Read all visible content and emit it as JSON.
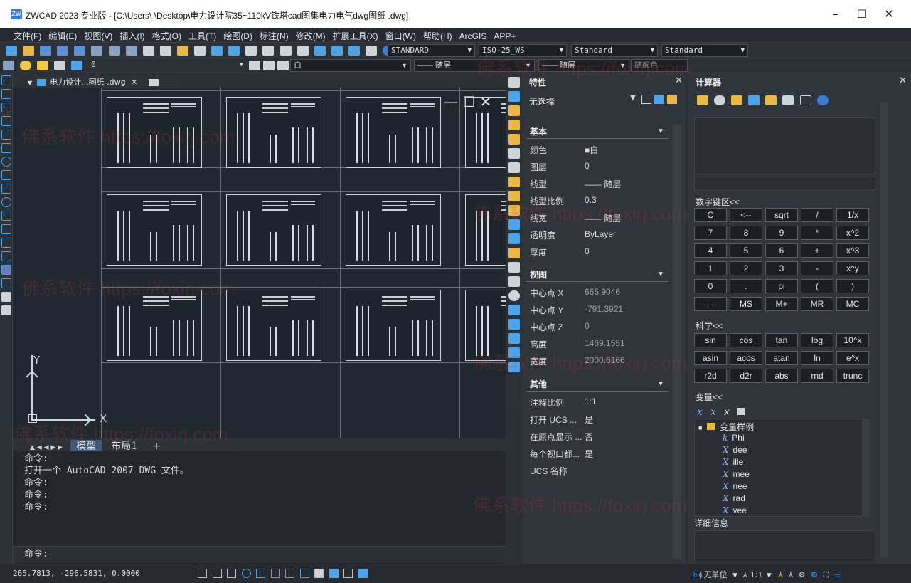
{
  "window": {
    "title": "ZWCAD 2023 专业版 - [C:\\Users\\        \\Desktop\\电力设计院35~110kV铁塔cad图集电力电气dwg图纸 .dwg]",
    "app_icon": "ZW",
    "minimize": "–",
    "maximize": "☐",
    "close": "✕"
  },
  "menu": [
    "文件(F)",
    "编辑(E)",
    "视图(V)",
    "插入(I)",
    "格式(O)",
    "工具(T)",
    "绘图(D)",
    "标注(N)",
    "修改(M)",
    "扩展工具(X)",
    "窗口(W)",
    "帮助(H)",
    "ArcGIS",
    "APP+"
  ],
  "toolbar": {
    "text_style": "STANDARD",
    "dim_style": "ISO-25_WS",
    "table_style": "Standard",
    "multileader_style": "Standard",
    "layer": "0",
    "color": "白",
    "linetype": "—— 随层",
    "lineweight": "—— 随层",
    "plotstyle": "随颜色"
  },
  "doc_tab": {
    "label": "电力设计...图纸 .dwg",
    "close": "✕"
  },
  "layout_tabs": [
    "模型",
    "布局1",
    "+"
  ],
  "command": {
    "history": [
      "命令:",
      "打开一个 AutoCAD 2007 DWG 文件。",
      "命令:",
      "命令:",
      "命令:"
    ],
    "prompt": "命令:"
  },
  "properties": {
    "title": "特性",
    "close": "✕",
    "selection": "无选择",
    "sections": {
      "basic": {
        "title": "基本",
        "rows": [
          {
            "k": "颜色",
            "v": "■白"
          },
          {
            "k": "图层",
            "v": "0"
          },
          {
            "k": "线型",
            "v": "—— 随层"
          },
          {
            "k": "线型比例",
            "v": "0.3"
          },
          {
            "k": "线宽",
            "v": "—— 随层"
          },
          {
            "k": "透明度",
            "v": "ByLayer"
          },
          {
            "k": "厚度",
            "v": "0"
          }
        ]
      },
      "view": {
        "title": "视图",
        "rows": [
          {
            "k": "中心点 X",
            "v": "665.9046"
          },
          {
            "k": "中心点 Y",
            "v": "-791.3921"
          },
          {
            "k": "中心点 Z",
            "v": "0"
          },
          {
            "k": "高度",
            "v": "1469.1551"
          },
          {
            "k": "宽度",
            "v": "2000.6166"
          }
        ]
      },
      "misc": {
        "title": "其他",
        "rows": [
          {
            "k": "注释比例",
            "v": "1:1"
          },
          {
            "k": "打开 UCS ...",
            "v": "是"
          },
          {
            "k": "在原点显示 ...",
            "v": "否"
          },
          {
            "k": "每个视口都...",
            "v": "是"
          },
          {
            "k": "UCS 名称",
            "v": ""
          }
        ]
      }
    }
  },
  "calculator": {
    "title": "计算器",
    "close": "✕",
    "numpad_label": "数字键区<<",
    "numpad": [
      [
        "C",
        "<--",
        "sqrt",
        "/",
        "1/x"
      ],
      [
        "7",
        "8",
        "9",
        "*",
        "x^2"
      ],
      [
        "4",
        "5",
        "6",
        "+",
        "x^3"
      ],
      [
        "1",
        "2",
        "3",
        "-",
        "x^y"
      ],
      [
        "0",
        ".",
        "pi",
        "(",
        ")"
      ],
      [
        "=",
        "MS",
        "M+",
        "MR",
        "MC"
      ]
    ],
    "sci_label": "科学<<",
    "sci": [
      [
        "sin",
        "cos",
        "tan",
        "log",
        "10^x"
      ],
      [
        "asin",
        "acos",
        "atan",
        "ln",
        "e^x"
      ],
      [
        "r2d",
        "d2r",
        "abs",
        "rnd",
        "trunc"
      ]
    ],
    "vars_label": "变量<<",
    "vars_group": "变量样例",
    "vars": [
      {
        "icon": "k",
        "name": "Phi"
      },
      {
        "icon": "X",
        "name": "dee"
      },
      {
        "icon": "X",
        "name": "ille"
      },
      {
        "icon": "X",
        "name": "mee"
      },
      {
        "icon": "X",
        "name": "nee"
      },
      {
        "icon": "X",
        "name": "rad"
      },
      {
        "icon": "X",
        "name": "vee"
      }
    ],
    "details_label": "详细信息"
  },
  "status": {
    "coords": "265.7813,  -296.5831,  0.0000",
    "units": "无单位",
    "scale": "1:1"
  },
  "axes": {
    "y": "Y",
    "x": "X"
  },
  "watermark": "佛系软件 https://foxirj.com"
}
